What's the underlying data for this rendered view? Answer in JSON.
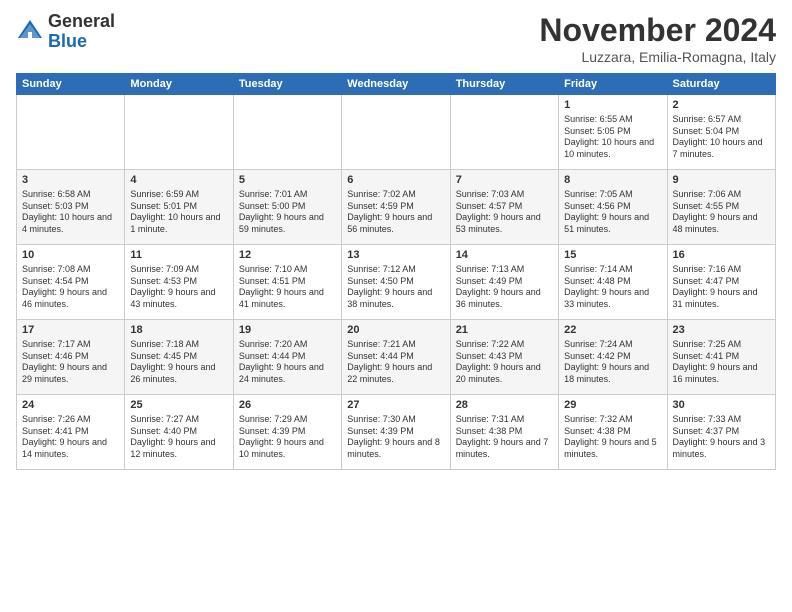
{
  "logo": {
    "general": "General",
    "blue": "Blue"
  },
  "header": {
    "month": "November 2024",
    "location": "Luzzara, Emilia-Romagna, Italy"
  },
  "weekdays": [
    "Sunday",
    "Monday",
    "Tuesday",
    "Wednesday",
    "Thursday",
    "Friday",
    "Saturday"
  ],
  "weeks": [
    [
      {
        "day": "",
        "info": ""
      },
      {
        "day": "",
        "info": ""
      },
      {
        "day": "",
        "info": ""
      },
      {
        "day": "",
        "info": ""
      },
      {
        "day": "",
        "info": ""
      },
      {
        "day": "1",
        "info": "Sunrise: 6:55 AM\nSunset: 5:05 PM\nDaylight: 10 hours and 10 minutes."
      },
      {
        "day": "2",
        "info": "Sunrise: 6:57 AM\nSunset: 5:04 PM\nDaylight: 10 hours and 7 minutes."
      }
    ],
    [
      {
        "day": "3",
        "info": "Sunrise: 6:58 AM\nSunset: 5:03 PM\nDaylight: 10 hours and 4 minutes."
      },
      {
        "day": "4",
        "info": "Sunrise: 6:59 AM\nSunset: 5:01 PM\nDaylight: 10 hours and 1 minute."
      },
      {
        "day": "5",
        "info": "Sunrise: 7:01 AM\nSunset: 5:00 PM\nDaylight: 9 hours and 59 minutes."
      },
      {
        "day": "6",
        "info": "Sunrise: 7:02 AM\nSunset: 4:59 PM\nDaylight: 9 hours and 56 minutes."
      },
      {
        "day": "7",
        "info": "Sunrise: 7:03 AM\nSunset: 4:57 PM\nDaylight: 9 hours and 53 minutes."
      },
      {
        "day": "8",
        "info": "Sunrise: 7:05 AM\nSunset: 4:56 PM\nDaylight: 9 hours and 51 minutes."
      },
      {
        "day": "9",
        "info": "Sunrise: 7:06 AM\nSunset: 4:55 PM\nDaylight: 9 hours and 48 minutes."
      }
    ],
    [
      {
        "day": "10",
        "info": "Sunrise: 7:08 AM\nSunset: 4:54 PM\nDaylight: 9 hours and 46 minutes."
      },
      {
        "day": "11",
        "info": "Sunrise: 7:09 AM\nSunset: 4:53 PM\nDaylight: 9 hours and 43 minutes."
      },
      {
        "day": "12",
        "info": "Sunrise: 7:10 AM\nSunset: 4:51 PM\nDaylight: 9 hours and 41 minutes."
      },
      {
        "day": "13",
        "info": "Sunrise: 7:12 AM\nSunset: 4:50 PM\nDaylight: 9 hours and 38 minutes."
      },
      {
        "day": "14",
        "info": "Sunrise: 7:13 AM\nSunset: 4:49 PM\nDaylight: 9 hours and 36 minutes."
      },
      {
        "day": "15",
        "info": "Sunrise: 7:14 AM\nSunset: 4:48 PM\nDaylight: 9 hours and 33 minutes."
      },
      {
        "day": "16",
        "info": "Sunrise: 7:16 AM\nSunset: 4:47 PM\nDaylight: 9 hours and 31 minutes."
      }
    ],
    [
      {
        "day": "17",
        "info": "Sunrise: 7:17 AM\nSunset: 4:46 PM\nDaylight: 9 hours and 29 minutes."
      },
      {
        "day": "18",
        "info": "Sunrise: 7:18 AM\nSunset: 4:45 PM\nDaylight: 9 hours and 26 minutes."
      },
      {
        "day": "19",
        "info": "Sunrise: 7:20 AM\nSunset: 4:44 PM\nDaylight: 9 hours and 24 minutes."
      },
      {
        "day": "20",
        "info": "Sunrise: 7:21 AM\nSunset: 4:44 PM\nDaylight: 9 hours and 22 minutes."
      },
      {
        "day": "21",
        "info": "Sunrise: 7:22 AM\nSunset: 4:43 PM\nDaylight: 9 hours and 20 minutes."
      },
      {
        "day": "22",
        "info": "Sunrise: 7:24 AM\nSunset: 4:42 PM\nDaylight: 9 hours and 18 minutes."
      },
      {
        "day": "23",
        "info": "Sunrise: 7:25 AM\nSunset: 4:41 PM\nDaylight: 9 hours and 16 minutes."
      }
    ],
    [
      {
        "day": "24",
        "info": "Sunrise: 7:26 AM\nSunset: 4:41 PM\nDaylight: 9 hours and 14 minutes."
      },
      {
        "day": "25",
        "info": "Sunrise: 7:27 AM\nSunset: 4:40 PM\nDaylight: 9 hours and 12 minutes."
      },
      {
        "day": "26",
        "info": "Sunrise: 7:29 AM\nSunset: 4:39 PM\nDaylight: 9 hours and 10 minutes."
      },
      {
        "day": "27",
        "info": "Sunrise: 7:30 AM\nSunset: 4:39 PM\nDaylight: 9 hours and 8 minutes."
      },
      {
        "day": "28",
        "info": "Sunrise: 7:31 AM\nSunset: 4:38 PM\nDaylight: 9 hours and 7 minutes."
      },
      {
        "day": "29",
        "info": "Sunrise: 7:32 AM\nSunset: 4:38 PM\nDaylight: 9 hours and 5 minutes."
      },
      {
        "day": "30",
        "info": "Sunrise: 7:33 AM\nSunset: 4:37 PM\nDaylight: 9 hours and 3 minutes."
      }
    ]
  ]
}
